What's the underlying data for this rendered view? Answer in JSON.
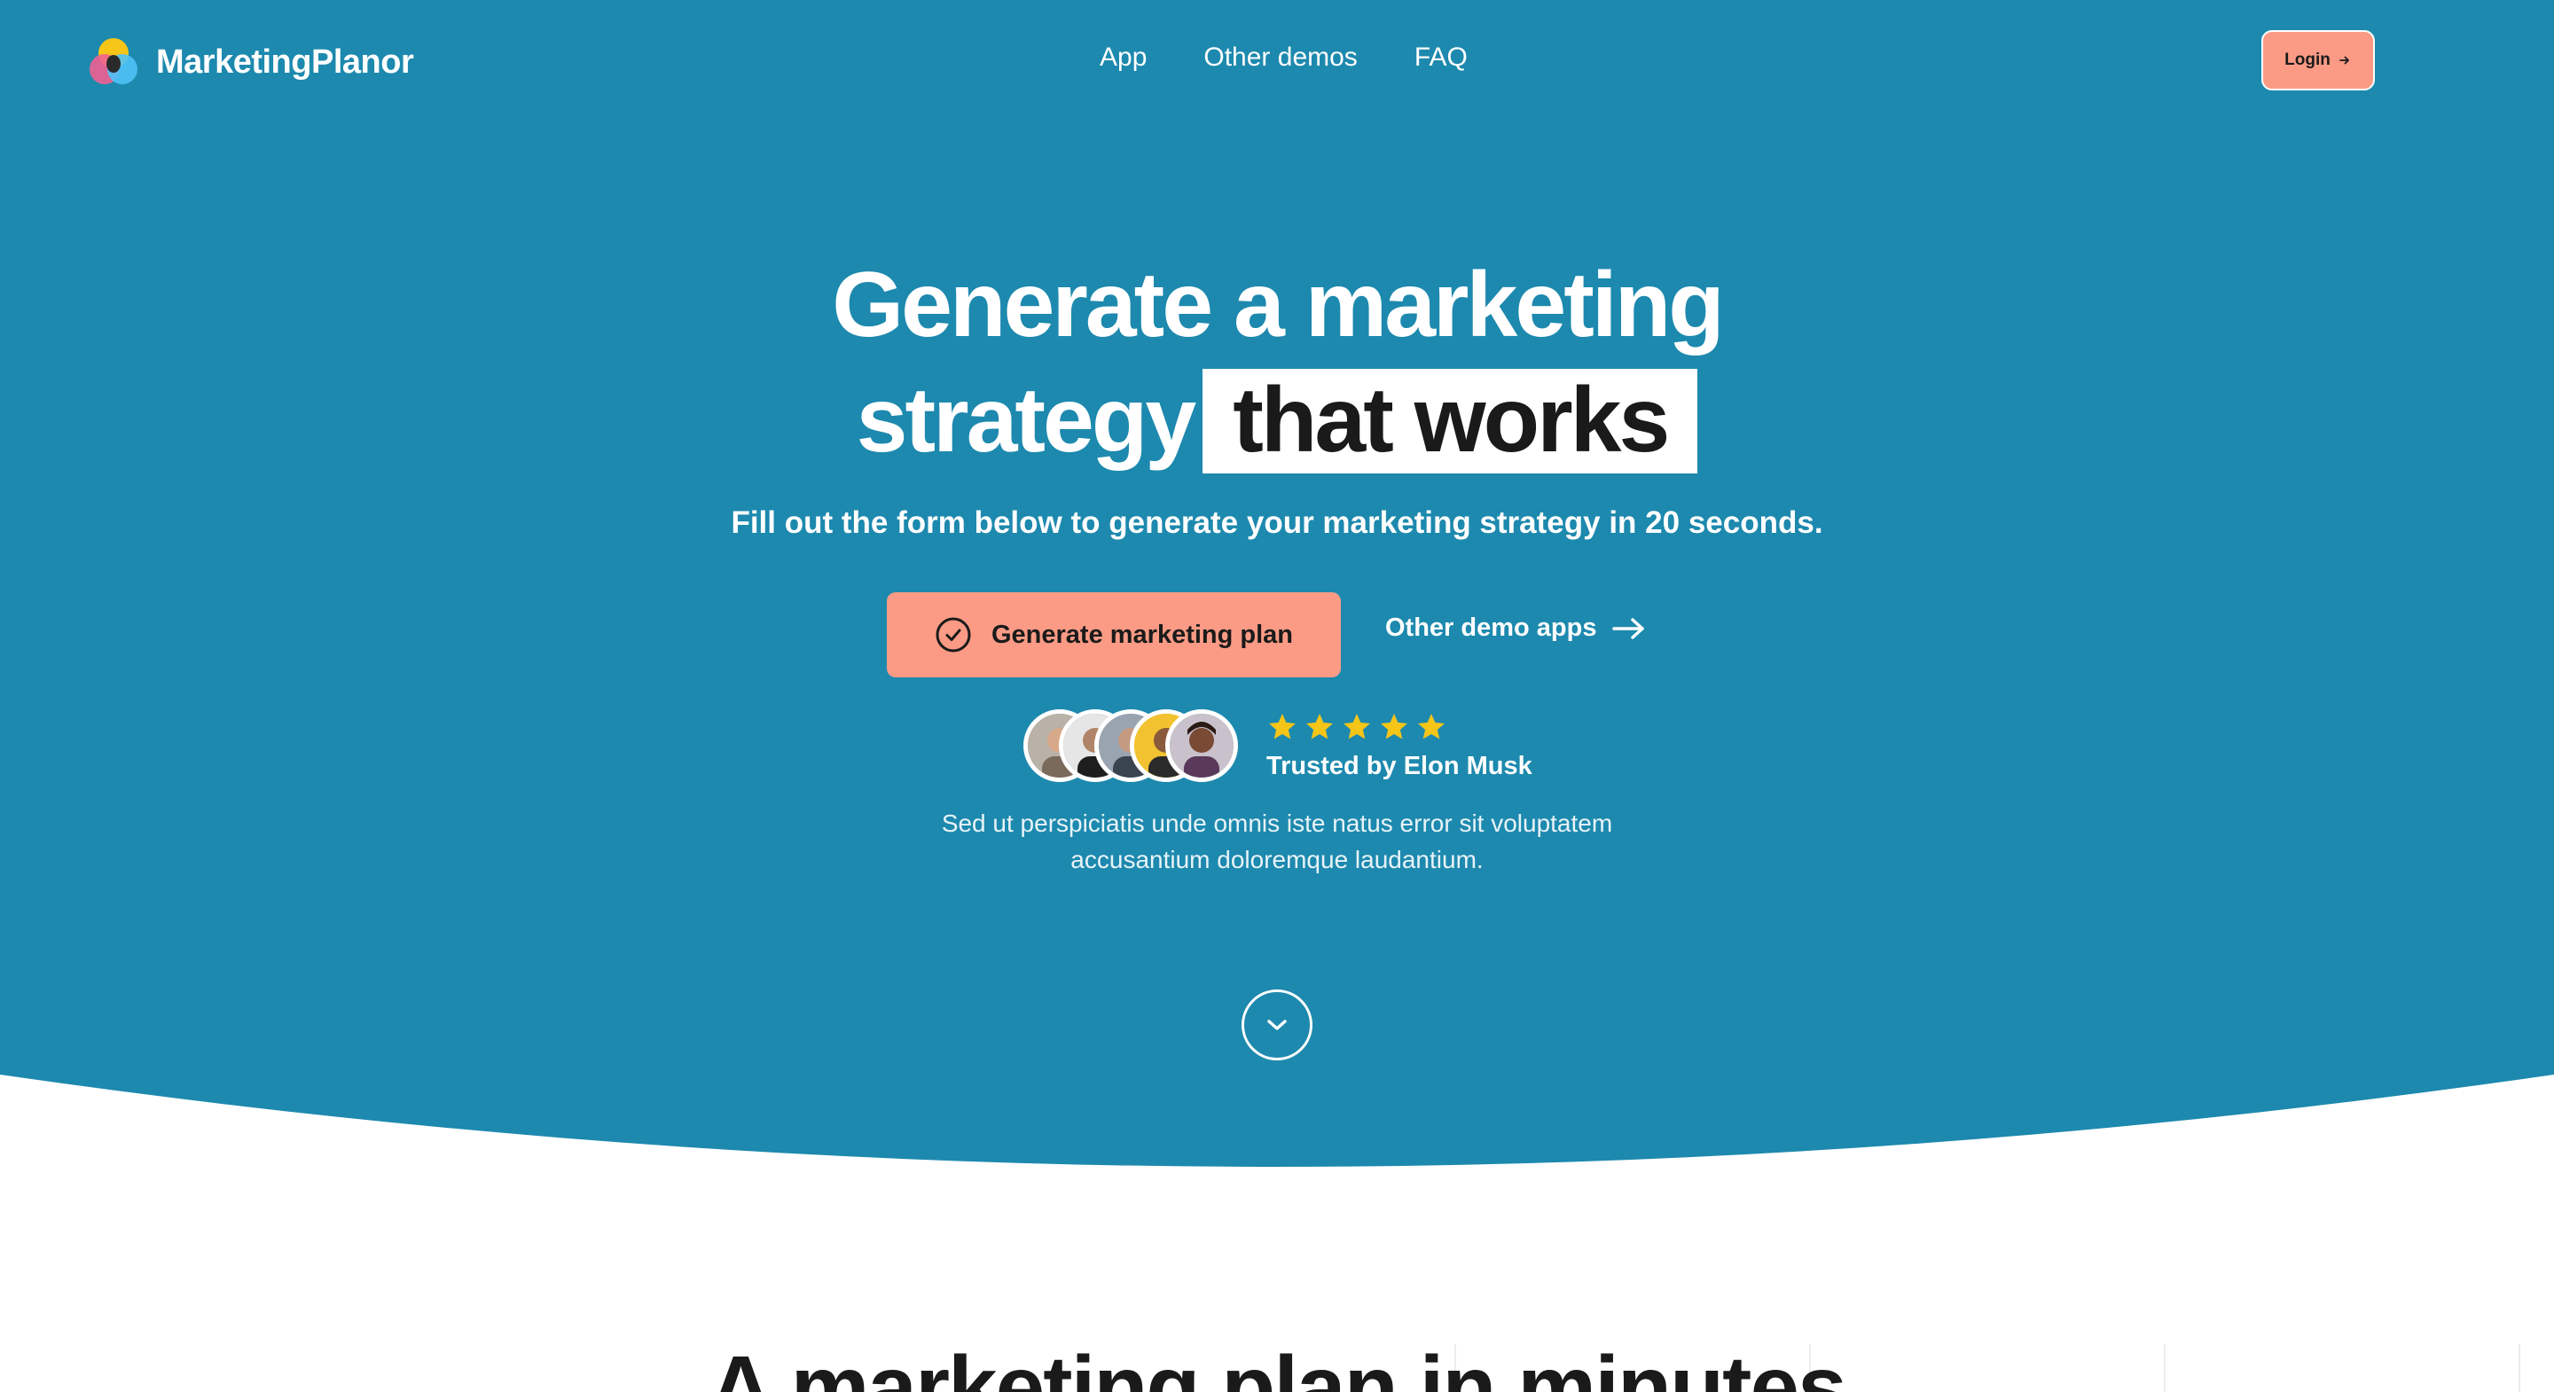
{
  "brand": {
    "name": "MarketingPlanor"
  },
  "nav": {
    "items": [
      "App",
      "Other demos",
      "FAQ"
    ],
    "login_label": "Login"
  },
  "hero": {
    "title_line1": "Generate a marketing",
    "title_line2_plain": "strategy",
    "title_line2_highlight": "that works",
    "subtitle": "Fill out the form below to generate your marketing strategy in 20 seconds.",
    "cta_label": "Generate marketing plan",
    "secondary_label": "Other demo apps",
    "rating": 5,
    "trusted_text": "Trusted by Elon Musk",
    "description_line1": "Sed ut perspiciatis unde omnis iste natus error sit voluptatem",
    "description_line2": "accusantium doloremque laudantium."
  },
  "next_section": {
    "title": "A marketing plan in minutes"
  },
  "colors": {
    "hero_bg": "#1d89ae",
    "accent": "#fb9b85",
    "star": "#f5c518"
  }
}
